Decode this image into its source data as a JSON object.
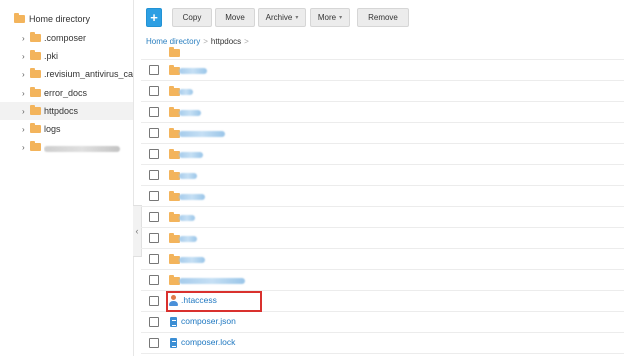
{
  "sidebar": {
    "root_label": "Home directory",
    "items": [
      {
        "label": ".composer",
        "blurred": false,
        "active": false
      },
      {
        "label": ".pki",
        "blurred": false,
        "active": false
      },
      {
        "label": ".revisium_antivirus_cache",
        "blurred": false,
        "active": false
      },
      {
        "label": "error_docs",
        "blurred": false,
        "active": false
      },
      {
        "label": "httpdocs",
        "blurred": false,
        "active": true
      },
      {
        "label": "logs",
        "blurred": false,
        "active": false
      },
      {
        "label": "",
        "blurred": true,
        "active": false
      }
    ]
  },
  "toolbar": {
    "add_label": "+",
    "copy_label": "Copy",
    "move_label": "Move",
    "archive_label": "Archive",
    "more_label": "More",
    "remove_label": "Remove"
  },
  "breadcrumb": {
    "home": "Home directory",
    "separator": ">",
    "current": "httpdocs"
  },
  "files": [
    {
      "type": "folder",
      "name": "",
      "blurred": true
    },
    {
      "type": "folder",
      "name": "",
      "blurred": true
    },
    {
      "type": "folder",
      "name": "",
      "blurred": true
    },
    {
      "type": "folder",
      "name": "",
      "blurred": true
    },
    {
      "type": "folder",
      "name": "",
      "blurred": true
    },
    {
      "type": "folder",
      "name": "",
      "blurred": true
    },
    {
      "type": "folder",
      "name": "",
      "blurred": true
    },
    {
      "type": "folder",
      "name": "",
      "blurred": true
    },
    {
      "type": "folder",
      "name": "",
      "blurred": true
    },
    {
      "type": "folder",
      "name": "",
      "blurred": true
    },
    {
      "type": "folder",
      "name": "",
      "blurred": true
    },
    {
      "type": "user-file",
      "name": ".htaccess",
      "blurred": false,
      "highlighted": true
    },
    {
      "type": "file",
      "name": "composer.json",
      "blurred": false
    },
    {
      "type": "file",
      "name": "composer.lock",
      "blurred": false
    }
  ],
  "colors": {
    "accent": "#2d9fe3",
    "link": "#1f78c1",
    "folder": "#f3b45c",
    "highlight_border": "#d9312e"
  }
}
